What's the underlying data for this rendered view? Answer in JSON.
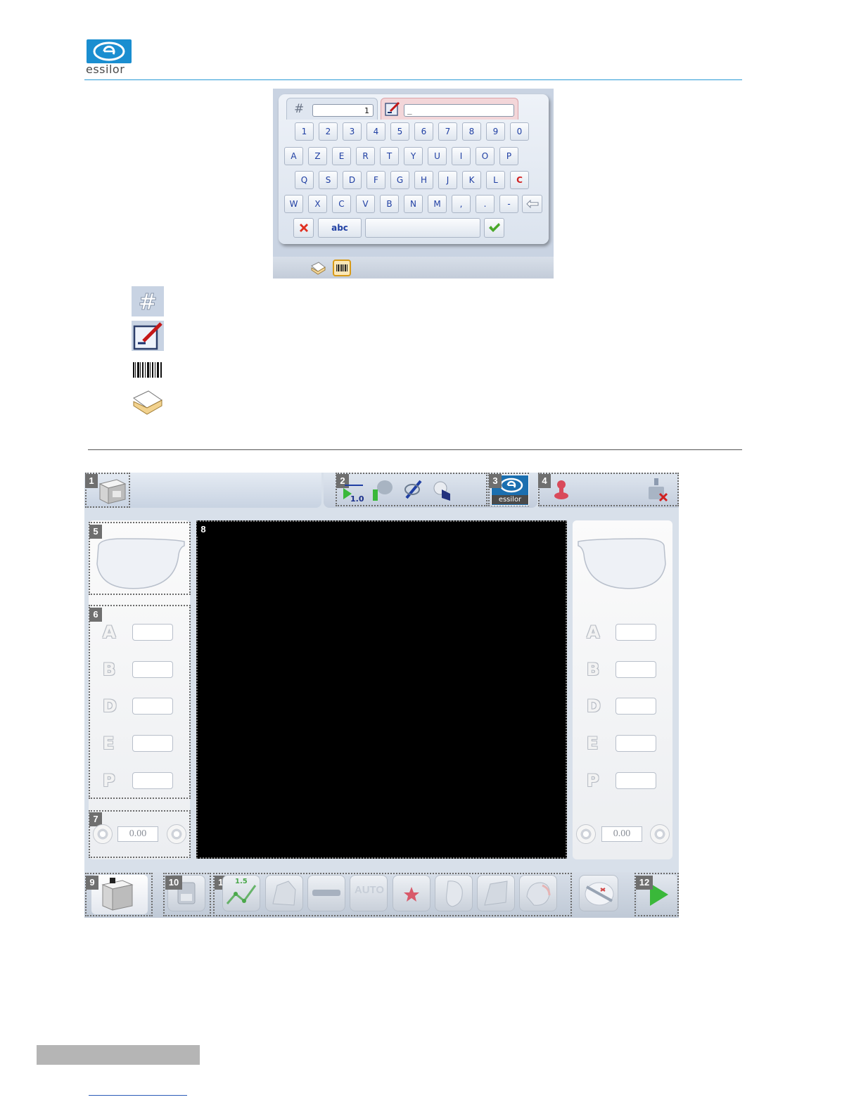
{
  "brand": {
    "name": "essilor",
    "color": "#1a8ed0"
  },
  "keyboard": {
    "job_number_value": "1",
    "text_value": "_",
    "rows": [
      [
        "1",
        "2",
        "3",
        "4",
        "5",
        "6",
        "7",
        "8",
        "9",
        "0"
      ],
      [
        "A",
        "Z",
        "E",
        "R",
        "T",
        "Y",
        "U",
        "I",
        "O",
        "P"
      ],
      [
        "Q",
        "S",
        "D",
        "F",
        "G",
        "H",
        "J",
        "K",
        "L",
        "C"
      ],
      [
        "W",
        "X",
        "C",
        "V",
        "B",
        "N",
        "M",
        ",",
        ".",
        "-"
      ]
    ],
    "mode_key_label": "abc",
    "icons": [
      "hash-icon",
      "edit-pencil-icon",
      "backspace-icon",
      "cancel-icon",
      "confirm-icon",
      "job-list-icon",
      "barcode-icon"
    ]
  },
  "legend_icons": [
    "hash-icon",
    "edit-pencil-icon",
    "barcode-icon",
    "job-list-icon"
  ],
  "machine_screen": {
    "callouts": [
      "1",
      "2",
      "3",
      "4",
      "5",
      "6",
      "7",
      "8",
      "9",
      "10",
      "11",
      "12"
    ],
    "tracing_speed_label": "1.0",
    "logo_label": "essilor",
    "left_panel": {
      "letters": [
        "A",
        "B",
        "D",
        "E",
        "P"
      ],
      "angle_value": "0.00"
    },
    "right_panel": {
      "letters": [
        "A",
        "B",
        "D",
        "E",
        "P"
      ],
      "angle_value": "0.00"
    },
    "retouch_value_label": "1.5",
    "auto_label": "AUTO"
  }
}
